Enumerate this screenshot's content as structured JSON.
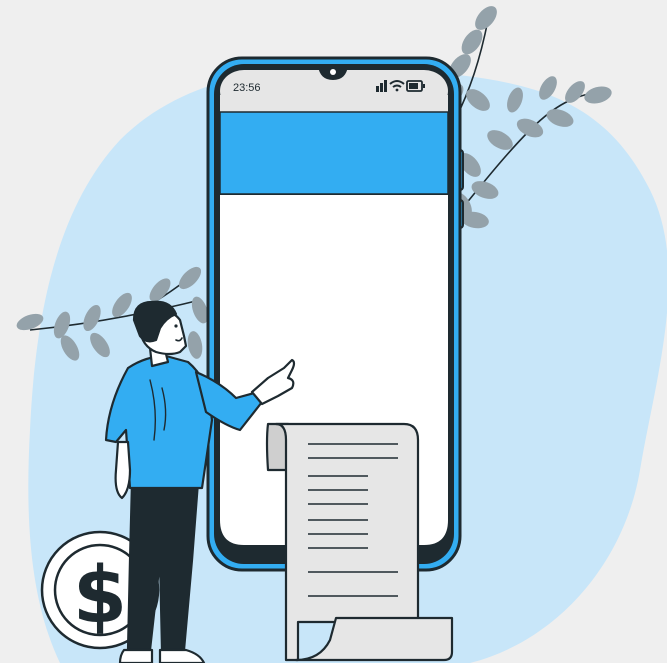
{
  "phone": {
    "status_time": "23:56",
    "header_color": "#33adf2",
    "screen_color": "#ffffff"
  },
  "icons": [
    "signal-icon",
    "wifi-icon",
    "battery-icon",
    "dollar-coin-icon",
    "receipt-icon",
    "leaf-branch-icon"
  ],
  "coin": {
    "symbol": "$"
  },
  "colors": {
    "background": "#efefef",
    "blob": "#c8e6f9",
    "accent": "#33adf2",
    "outline": "#1e2a30",
    "leaves": "#94a2aa",
    "paper": "#e6e6e6"
  }
}
